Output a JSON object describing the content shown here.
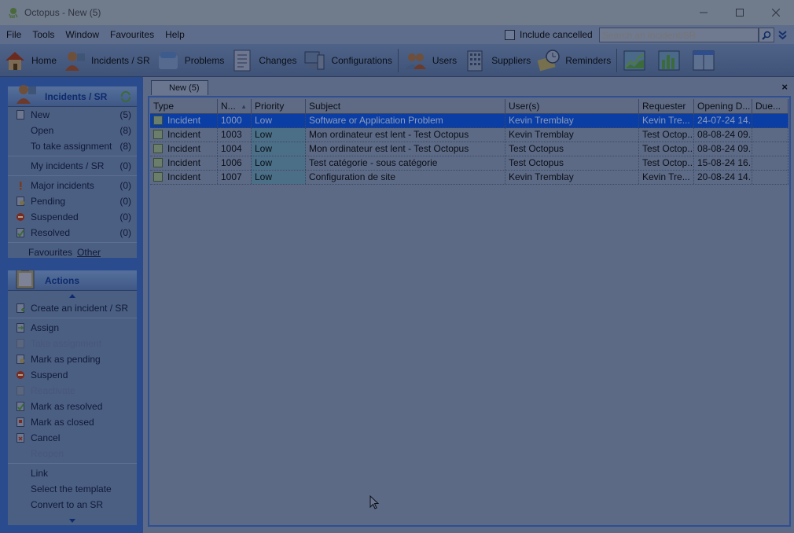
{
  "window": {
    "title": "Octopus - New (5)",
    "controls": [
      "minimize-icon",
      "maximize-icon",
      "close-icon"
    ]
  },
  "menu": {
    "items": [
      "File",
      "Tools",
      "Window",
      "Favourites",
      "Help"
    ],
    "include_cancelled": "Include cancelled",
    "search_placeholder": "Search an incident/SR"
  },
  "toolbar": {
    "items": [
      {
        "label": "Home",
        "icon": "house-icon"
      },
      {
        "label": "Incidents / SR",
        "icon": "user-incident-icon"
      },
      {
        "label": "Problems",
        "icon": "problems-icon"
      },
      {
        "label": "Changes",
        "icon": "changes-icon"
      },
      {
        "label": "Configurations",
        "icon": "computer-icon"
      },
      {
        "label": "Users",
        "icon": "users-icon"
      },
      {
        "label": "Suppliers",
        "icon": "building-icon"
      },
      {
        "label": "Reminders",
        "icon": "clock-icon"
      }
    ]
  },
  "incidents_panel": {
    "title": "Incidents / SR",
    "items": [
      {
        "label": "New",
        "count": "(5)",
        "icon": "page-icon"
      },
      {
        "label": "Open",
        "count": "(8)"
      },
      {
        "label": "To take assignment",
        "count": "(8)"
      },
      {
        "label": "My incidents / SR",
        "count": "(0)"
      },
      {
        "label": "Major incidents",
        "count": "(0)",
        "icon": "exclamation-icon"
      },
      {
        "label": "Pending",
        "count": "(0)",
        "icon": "pending-icon"
      },
      {
        "label": "Suspended",
        "count": "(0)",
        "icon": "stop-icon"
      },
      {
        "label": "Resolved",
        "count": "(0)",
        "icon": "check-icon"
      }
    ],
    "favourites": "Favourites",
    "other": "Other"
  },
  "actions_panel": {
    "title": "Actions",
    "items": [
      {
        "label": "Create an incident / SR",
        "enabled": true
      },
      {
        "label": "Assign",
        "enabled": true
      },
      {
        "label": "Take assignment",
        "enabled": false
      },
      {
        "label": "Mark as pending",
        "enabled": true
      },
      {
        "label": "Suspend",
        "enabled": true
      },
      {
        "label": "Reactivate",
        "enabled": false
      },
      {
        "label": "Mark as resolved",
        "enabled": true
      },
      {
        "label": "Mark as closed",
        "enabled": true
      },
      {
        "label": "Cancel",
        "enabled": true
      },
      {
        "label": "Reopen",
        "enabled": false
      },
      {
        "label": "Link",
        "enabled": true
      },
      {
        "label": "Select the template",
        "enabled": true
      },
      {
        "label": "Convert to an SR",
        "enabled": true
      }
    ]
  },
  "tab": {
    "label": "New (5)"
  },
  "grid": {
    "columns": [
      "Type",
      "N...",
      "Priority",
      "Subject",
      "User(s)",
      "Requester",
      "Opening D...",
      "Due..."
    ],
    "rows": [
      [
        "Incident",
        "1000",
        "Low",
        "Software or Application Problem",
        "Kevin Tremblay",
        "Kevin Tre...",
        "24-07-24 14...",
        ""
      ],
      [
        "Incident",
        "1003",
        "Low",
        "Mon ordinateur est lent - Test Octopus",
        "Kevin Tremblay",
        "Test Octop...",
        "08-08-24 09...",
        ""
      ],
      [
        "Incident",
        "1004",
        "Low",
        "Mon ordinateur est lent - Test Octopus",
        "Test Octopus",
        "Test Octop...",
        "08-08-24 09...",
        ""
      ],
      [
        "Incident",
        "1006",
        "Low",
        "Test catégorie - sous catégorie",
        "Test Octopus",
        "Test Octop...",
        "15-08-24 16...",
        ""
      ],
      [
        "Incident",
        "1007",
        "Low",
        "Configuration de site",
        "Kevin Tremblay",
        "Kevin Tre...",
        "20-08-24 14...",
        ""
      ]
    ],
    "selected_row": 0
  },
  "colors": {
    "selection": "#0a3ea5",
    "panel_header_text": "#0d2a6e"
  }
}
